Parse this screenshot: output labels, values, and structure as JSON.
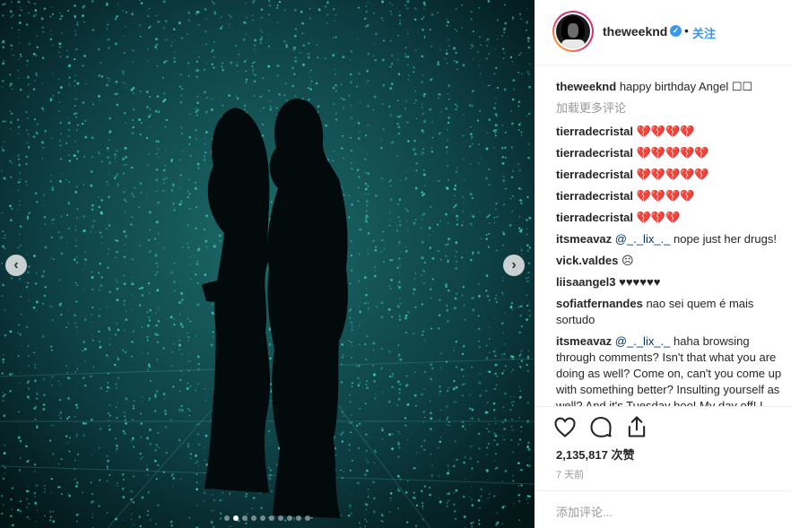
{
  "post": {
    "username": "theweeknd",
    "follow_label": "关注",
    "separator": "•",
    "caption": "happy birthday Angel ☐☐",
    "load_more": "加载更多评论",
    "likes": "2,135,817 次赞",
    "time": "7 天前",
    "add_comment_placeholder": "添加评论..."
  },
  "comments": [
    {
      "user": "tierradecristal",
      "text": "💔💔💔💔",
      "mention": ""
    },
    {
      "user": "tierradecristal",
      "text": "💔💔💔💔💔",
      "mention": ""
    },
    {
      "user": "tierradecristal",
      "text": "💔💔💔💔💔",
      "mention": ""
    },
    {
      "user": "tierradecristal",
      "text": "💔💔💔💔",
      "mention": ""
    },
    {
      "user": "tierradecristal",
      "text": "💔💔💔",
      "mention": ""
    },
    {
      "user": "itsmeavaz",
      "mention": "@_._lix_._",
      "text": "nope just her drugs!"
    },
    {
      "user": "vick.valdes",
      "text": "☹",
      "mention": ""
    },
    {
      "user": "liisaangel3",
      "text": "♥♥♥♥♥♥",
      "mention": ""
    },
    {
      "user": "sofiatfernandes",
      "text": "nao sei quem é mais sortudo",
      "mention": ""
    },
    {
      "user": "itsmeavaz",
      "mention": "@_._lix_._",
      "text": "haha browsing through comments? Isn't that what you are doing as well? Come on, can't you come up with something better? Insulting yourself as well? And it's Tuesday hoo! My day off! I"
    }
  ],
  "icons": {
    "prev": "chevron-left-icon",
    "next": "chevron-right-icon",
    "like": "heart-icon",
    "comment": "comment-icon",
    "share": "share-icon",
    "verified": "verified-badge-icon"
  },
  "carousel": {
    "count": 10,
    "active_index": 1
  },
  "colors": {
    "accent": "#3897f0",
    "photo_bg": "#052227",
    "lights": "#3fd6c4"
  }
}
